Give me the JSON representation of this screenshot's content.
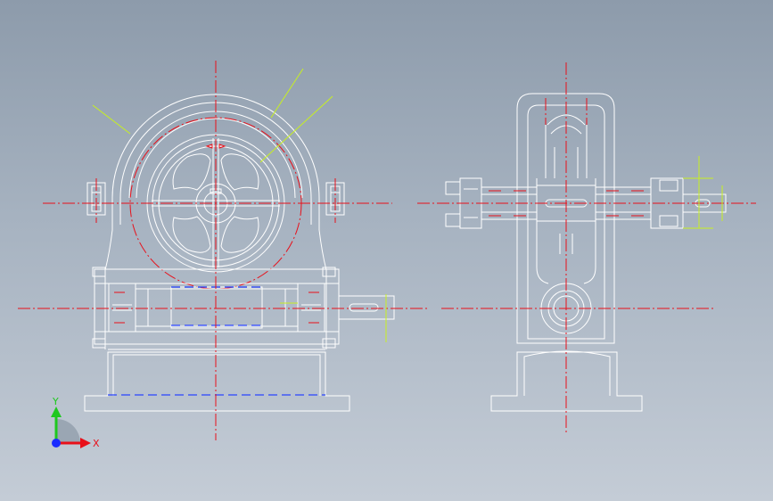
{
  "triad": {
    "x_label": "X",
    "y_label": "Y",
    "x_color": "#e8101a",
    "y_color": "#1ec81e",
    "z_color": "#1a2cff"
  },
  "colors": {
    "background": "#a7b3c1",
    "geometry": "#ffffff",
    "centerline": "#e8101a",
    "hidden": "#2a44ff",
    "leader": "#c8f020"
  }
}
